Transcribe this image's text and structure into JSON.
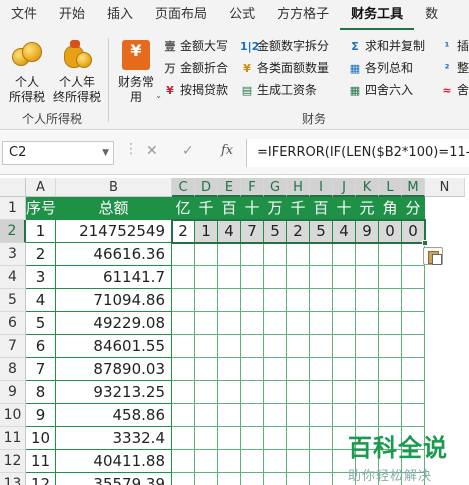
{
  "ribbon_tabs": [
    "文件",
    "开始",
    "插入",
    "页面布局",
    "公式",
    "方方格子",
    "财务工具",
    "数"
  ],
  "active_tab": "财务工具",
  "ribbon": {
    "personal_tax_label": "个人\n所得税",
    "year_end_tax_label": "个人年\n终所得税",
    "finance_common_label": "财务常\n用",
    "group_personal_tax": "个人所得税",
    "group_finance": "财务",
    "col1": [
      "金额大写",
      "金额折合",
      "按揭贷款"
    ],
    "col1_icons": [
      "壹",
      "万",
      "¥"
    ],
    "col2": [
      "金额数字拆分",
      "各类面额数量",
      "生成工资条"
    ],
    "col2_icons": [
      "1|2",
      "¥",
      "▤"
    ],
    "col3": [
      "求和并复制",
      "各列总和",
      "四舍六入"
    ],
    "col3_icons": [
      "Σ",
      "▦",
      "▦"
    ],
    "col4": [
      "插",
      "整",
      "舍"
    ],
    "col4_icons": [
      "¹",
      "²",
      "≈"
    ]
  },
  "formula_bar": {
    "name_box": "C2",
    "cancel": "✕",
    "confirm": "✓",
    "fx": "fx",
    "formula": "=IFERROR(IF(LEN($B2*100)=11-1,\""
  },
  "columns": [
    "A",
    "B",
    "C",
    "D",
    "E",
    "F",
    "G",
    "H",
    "I",
    "J",
    "K",
    "L",
    "M",
    "N"
  ],
  "rows": [
    "1",
    "2",
    "3",
    "4",
    "5",
    "6",
    "7",
    "8",
    "9",
    "10",
    "11",
    "12",
    "13"
  ],
  "header_row": {
    "seq": "序号",
    "amount": "总额",
    "units": [
      "亿",
      "千",
      "百",
      "十",
      "万",
      "千",
      "百",
      "十",
      "元",
      "角",
      "分"
    ]
  },
  "data_rows": [
    {
      "seq": "1",
      "amount": "214752549"
    },
    {
      "seq": "2",
      "amount": "46616.36"
    },
    {
      "seq": "3",
      "amount": "61141.7"
    },
    {
      "seq": "4",
      "amount": "71094.86"
    },
    {
      "seq": "5",
      "amount": "49229.08"
    },
    {
      "seq": "6",
      "amount": "84601.55"
    },
    {
      "seq": "7",
      "amount": "87890.03"
    },
    {
      "seq": "8",
      "amount": "93213.25"
    },
    {
      "seq": "9",
      "amount": "458.86"
    },
    {
      "seq": "10",
      "amount": "3332.4"
    },
    {
      "seq": "11",
      "amount": "40411.88"
    },
    {
      "seq": "12",
      "amount": "35579.39"
    }
  ],
  "row2_digits": [
    "2",
    "1",
    "4",
    "7",
    "5",
    "2",
    "5",
    "4",
    "9",
    "0",
    "0"
  ],
  "watermark": {
    "title": "百科全说",
    "subtitle": "助你轻松解决"
  },
  "colors": {
    "accent": "#217346",
    "header_fill": "#1e9147",
    "digit_fill": "#d9d9d9"
  }
}
